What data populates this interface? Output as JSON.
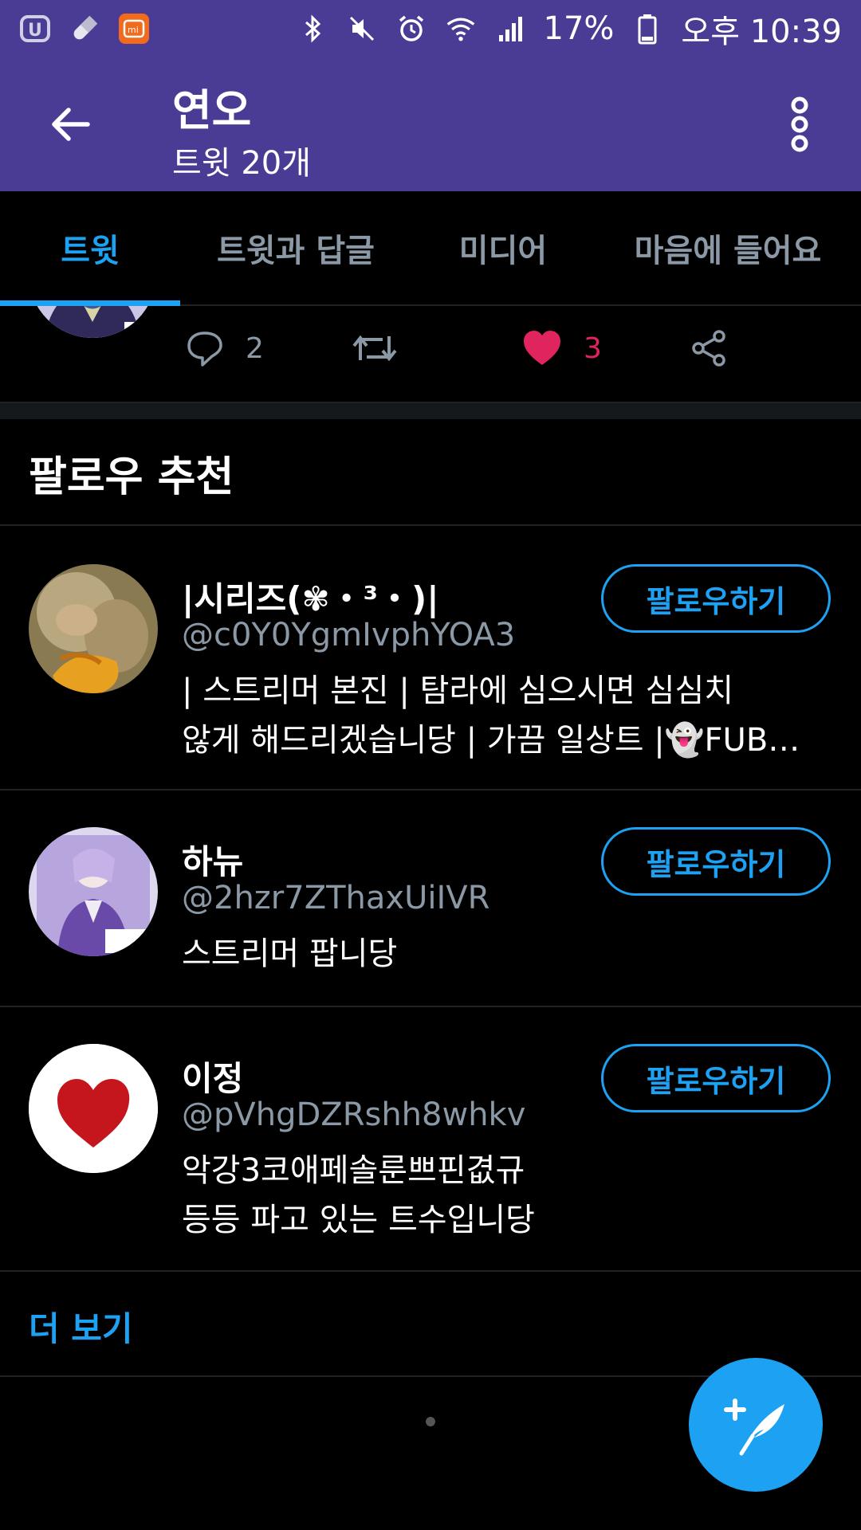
{
  "status_bar": {
    "battery": "17%",
    "time": "오후 10:39",
    "left_icons": [
      "u-plus-icon",
      "pill-icon",
      "mi-icon"
    ],
    "right_icons": [
      "bluetooth-icon",
      "mute-icon",
      "alarm-icon",
      "wifi-icon",
      "signal-icon",
      "battery-icon"
    ]
  },
  "header": {
    "title": "연오",
    "subtitle": "트윗 20개"
  },
  "tabs": [
    {
      "label": "트윗",
      "active": true
    },
    {
      "label": "트윗과 답글",
      "active": false
    },
    {
      "label": "미디어",
      "active": false
    },
    {
      "label": "마음에 들어요",
      "active": false
    }
  ],
  "tweet_actions": {
    "reply_count": "2",
    "retweet_count": "",
    "like_count": "3"
  },
  "who_to_follow": {
    "title": "팔로우 추천",
    "users": [
      {
        "name": "|시리즈(✾・³・)|",
        "handle": "@c0Y0YgmIvphYOA3",
        "bio_lines": [
          "| 스트리머 본진 | 탐라에 심으시면 심심치",
          "않게 해드리겠습니당 | 가끔 일상트 |👻FUB…"
        ],
        "follow_label": "팔로우하기"
      },
      {
        "name": "하뉴",
        "handle": "@2hzr7ZThaxUiIVR",
        "bio_lines": [
          "스트리머 팝니당"
        ],
        "follow_label": "팔로우하기"
      },
      {
        "name": "이정",
        "handle": "@pVhgDZRshh8whkv",
        "bio_lines": [
          "악강3코애페솔룬쁘핀겺규",
          "등등 파고 있는 트수입니당"
        ],
        "follow_label": "팔로우하기"
      }
    ],
    "more_label": "더 보기"
  },
  "colors": {
    "header_bg": "#4a3c94",
    "accent": "#1da1f2",
    "like": "#e0245e",
    "muted": "#8b98a5",
    "background": "#000000"
  }
}
